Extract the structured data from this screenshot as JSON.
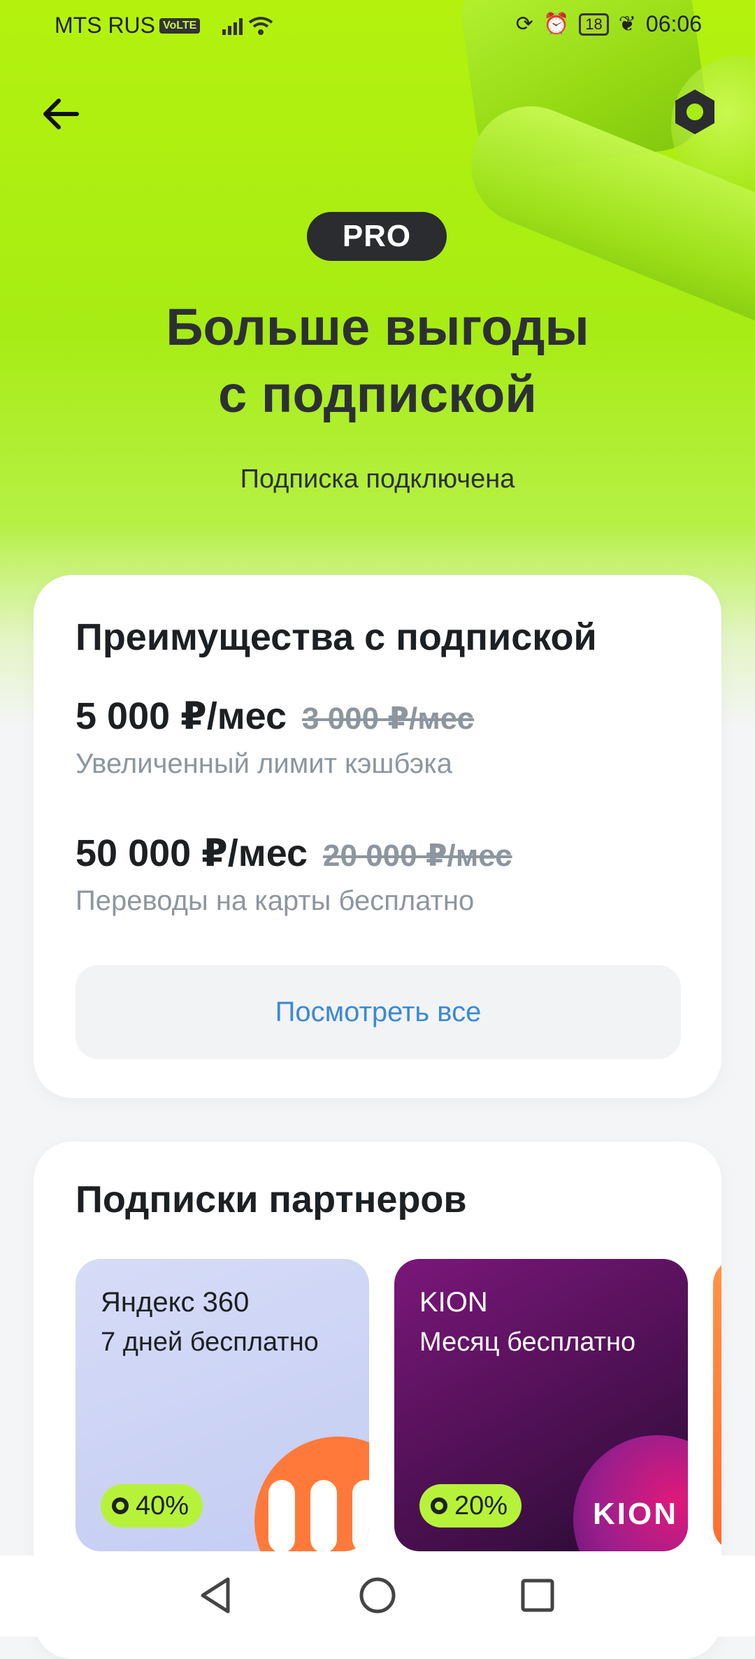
{
  "status_bar": {
    "carrier": "MTS RUS",
    "volte": "VoLTE",
    "battery": "18",
    "time": "06:06"
  },
  "header": {
    "back_icon": "arrow-left-icon",
    "settings_icon": "hexagon-settings-icon"
  },
  "hero": {
    "badge": "PRO",
    "title_line1": "Больше выгоды",
    "title_line2": "с подпиской",
    "subtitle": "Подписка подключена"
  },
  "benefits": {
    "title": "Преимущества с подпиской",
    "items": [
      {
        "value": "5 000 ₽/мес",
        "old_value": "3 000 ₽/мес",
        "description": "Увеличенный лимит кэшбэка"
      },
      {
        "value": "50 000 ₽/мес",
        "old_value": "20 000 ₽/мес",
        "description": "Переводы на карты бесплатно"
      }
    ],
    "see_all": "Посмотреть все"
  },
  "partners": {
    "title": "Подписки партнеров",
    "items": [
      {
        "name": "Яндекс 360",
        "offer": "7 дней бесплатно",
        "cashback": "40%"
      },
      {
        "name": "KION",
        "offer": "Месяц бесплатно",
        "cashback": "20%",
        "logo_text": "KION"
      }
    ]
  },
  "colors": {
    "accent_green": "#B4F20E",
    "link_blue": "#3B89D6",
    "muted_text": "#8D969F"
  }
}
